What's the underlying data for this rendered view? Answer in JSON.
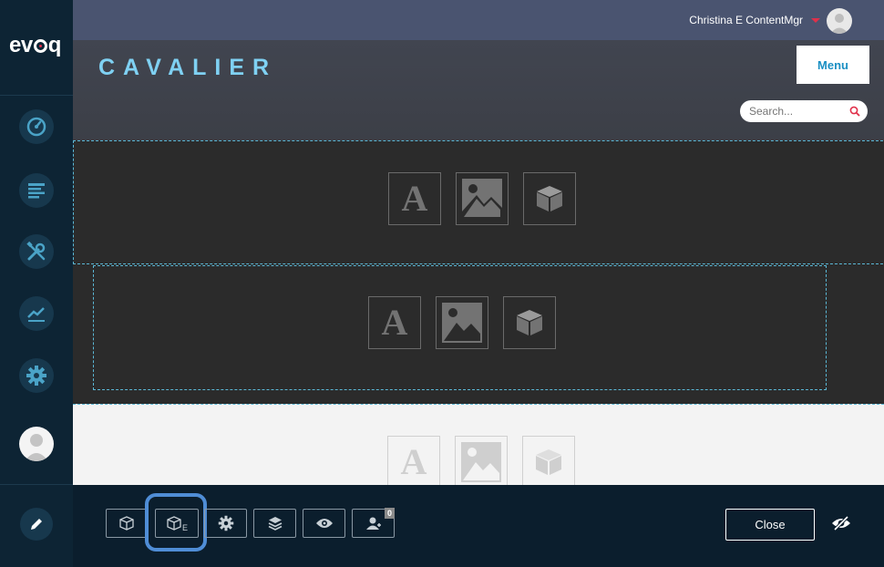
{
  "app": {
    "logo_text_a": "ev",
    "logo_text_b": "q"
  },
  "sidebar": {
    "items": [
      {
        "icon": "dashboard-gauge-icon"
      },
      {
        "icon": "content-list-icon"
      },
      {
        "icon": "tools-icon"
      },
      {
        "icon": "analytics-chart-icon"
      },
      {
        "icon": "settings-gear-icon"
      }
    ],
    "user_avatar": "avatar",
    "edit_icon": "pencil-icon"
  },
  "topbar": {
    "username": "Christina E ContentMgr"
  },
  "header": {
    "brand": "CAVALIER",
    "menu_label": "Menu",
    "search_placeholder": "Search..."
  },
  "modules": {
    "text_glyph": "A",
    "items": [
      "text-module-icon",
      "image-module-icon",
      "module-cube-icon"
    ]
  },
  "toolbar": {
    "existing_module_sub": "E",
    "user_badge": "0",
    "close_label": "Close"
  },
  "colors": {
    "brand": "#7fd1f3",
    "accent_red": "#e0304a",
    "highlight": "#4f8dd6"
  }
}
